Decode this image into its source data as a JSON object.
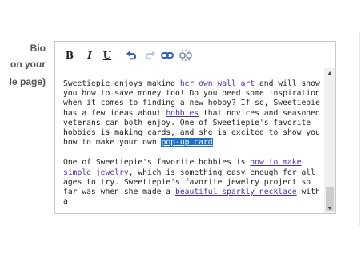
{
  "labels": {
    "line1": "Bio",
    "line2": "on your",
    "line3": "le page)"
  },
  "toolbar": {
    "bold": "B",
    "italic": "I",
    "underline": "U",
    "icons": [
      "undo-icon",
      "redo-icon",
      "link-icon",
      "unlink-icon"
    ]
  },
  "content": {
    "p1": {
      "t1": "Sweetiepie enjoys making ",
      "a1": "her own wall art",
      "t2": " and will show you how to save money too!  Do you need some inspiration when it comes to finding a new hobby?  If so, Sweetiepie has a few ideas about ",
      "a2": "hobbies",
      "t3": " that novices and seasoned veterans can both enjoy.  One of Sweetiepie's favorite hobbies is making cards, and she is excited to show you how to make your own ",
      "a3": "pop-up card",
      "t4": "."
    },
    "p2": {
      "t1": "One of Sweetiepie's favorite hobbies is ",
      "a1": "how to make simple jewelry",
      "t2": ", which is something easy enough for all ages to try.  Sweetiepie's favorite jewelry project so far was when she made a ",
      "a2": "beautiful sparkly necklace",
      "t3": " with a"
    }
  },
  "scrollbar": {
    "position_fraction": 0.85
  },
  "colors": {
    "link": "#4b2fa6",
    "selection": "#1e6fc6",
    "label": "#555555"
  }
}
